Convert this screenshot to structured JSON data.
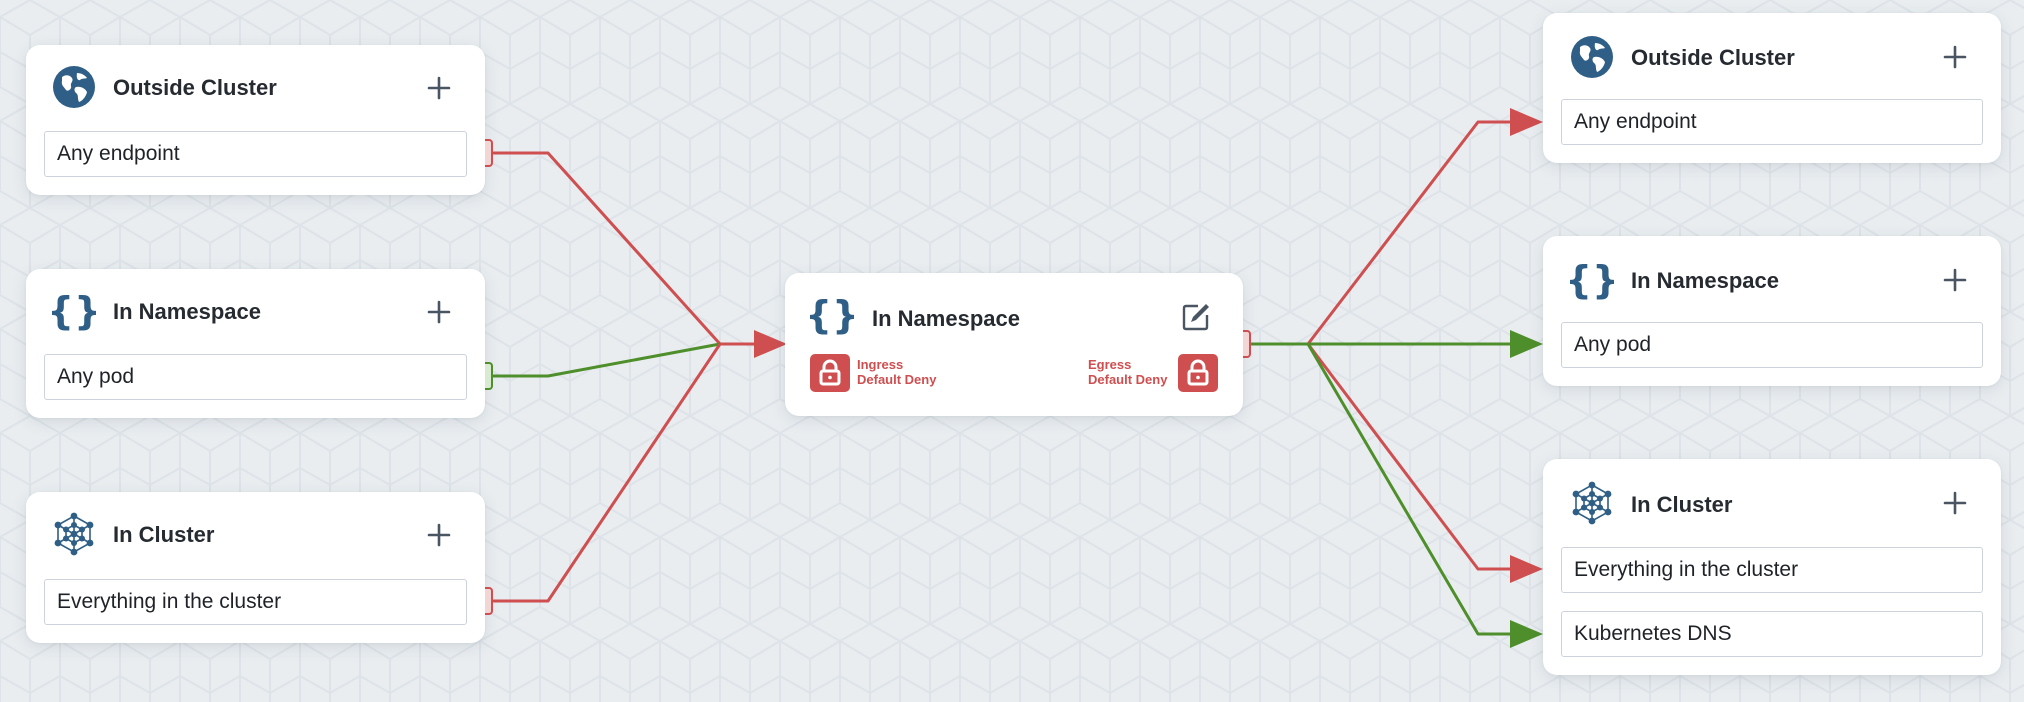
{
  "colors": {
    "deny": "#cf4f50",
    "allow": "#4f8f2b",
    "icon_blue": "#2f5f86",
    "card_bg": "#ffffff",
    "canvas_bg": "#e9edf0"
  },
  "ingress": [
    {
      "title": "Outside Cluster",
      "icon": "globe-icon",
      "items": [
        "Any endpoint"
      ],
      "status": "deny"
    },
    {
      "title": "In Namespace",
      "icon": "braces-icon",
      "items": [
        "Any pod"
      ],
      "status": "allow"
    },
    {
      "title": "In Cluster",
      "icon": "cluster-icon",
      "items": [
        "Everything in the cluster"
      ],
      "status": "deny"
    }
  ],
  "center": {
    "title": "In Namespace",
    "icon": "braces-icon",
    "ingress_label": "Ingress",
    "ingress_sub": "Default Deny",
    "egress_label": "Egress",
    "egress_sub": "Default Deny"
  },
  "egress": [
    {
      "title": "Outside Cluster",
      "icon": "globe-icon",
      "items": [
        "Any endpoint"
      ],
      "item_status": [
        "deny"
      ]
    },
    {
      "title": "In Namespace",
      "icon": "braces-icon",
      "items": [
        "Any pod"
      ],
      "item_status": [
        "allow"
      ]
    },
    {
      "title": "In Cluster",
      "icon": "cluster-icon",
      "items": [
        "Everything in the cluster",
        "Kubernetes DNS"
      ],
      "item_status": [
        "deny",
        "allow"
      ]
    }
  ]
}
